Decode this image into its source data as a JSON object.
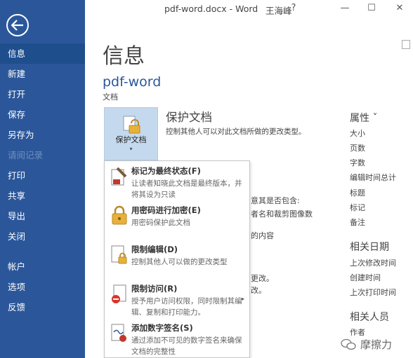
{
  "window": {
    "title": "pdf-word.docx - Word",
    "user": "王海峰",
    "help": "?",
    "minimize": "—",
    "restore": "☐",
    "close": "✕"
  },
  "sidebar": {
    "items": [
      {
        "label": "信息",
        "state": "active"
      },
      {
        "label": "新建",
        "state": "normal"
      },
      {
        "label": "打开",
        "state": "normal"
      },
      {
        "label": "保存",
        "state": "normal"
      },
      {
        "label": "另存为",
        "state": "normal"
      },
      {
        "label": "请阅记录",
        "state": "disabled"
      },
      {
        "label": "打印",
        "state": "normal"
      },
      {
        "label": "共享",
        "state": "normal"
      },
      {
        "label": "导出",
        "state": "normal"
      },
      {
        "label": "关闭",
        "state": "normal"
      },
      {
        "label": "帐户",
        "state": "normal"
      },
      {
        "label": "选项",
        "state": "normal"
      },
      {
        "label": "反馈",
        "state": "normal"
      }
    ]
  },
  "main": {
    "title": "信息",
    "doc_name": "pdf-word",
    "doc_path": "文档",
    "protect": {
      "tile_label": "保护文档",
      "caret": "▾",
      "title": "保护文档",
      "description": "控制其他人可以对此文档所做的更改类型。"
    },
    "behind": [
      "意其是否包含:",
      "者名和裁剪图像数",
      "的内容",
      "更改。",
      "改。"
    ]
  },
  "properties": {
    "heading": "属性 ˇ",
    "items": [
      "大小",
      "页数",
      "字数",
      "编辑时间总计",
      "标题",
      "标记",
      "备注"
    ],
    "dates_heading": "相关日期",
    "dates": [
      "上次修改时间",
      "创建时间",
      "上次打印时间"
    ],
    "people_heading": "相关人员",
    "people": [
      "作者"
    ]
  },
  "menu": {
    "items": [
      {
        "title": "标记为最终状态(F)",
        "desc": "让读者知晓此文档是最终版本，并将其设为只读",
        "icon": "mark-final-icon"
      },
      {
        "title": "用密码进行加密(E)",
        "desc": "用密码保护此文档",
        "icon": "key-lock-icon"
      },
      {
        "title": "限制编辑(D)",
        "desc": "控制其他人可以做的更改类型",
        "icon": "document-lock-icon"
      },
      {
        "title": "限制访问(R)",
        "desc": "授予用户访问权限，同时限制其编辑、复制和打印能力。",
        "icon": "restrict-access-icon",
        "has_submenu": true
      },
      {
        "title": "添加数字签名(S)",
        "desc": "通过添加不可见的数字签名来确保文档的完整性",
        "icon": "digital-signature-icon"
      }
    ],
    "submenu_arrow": "▸"
  },
  "watermark": {
    "text": "摩擦力",
    "icon": "wechat-icon"
  },
  "colors": {
    "sidebar": "#2b579a",
    "accent": "#2b579a",
    "tile": "#c5d9ee"
  }
}
